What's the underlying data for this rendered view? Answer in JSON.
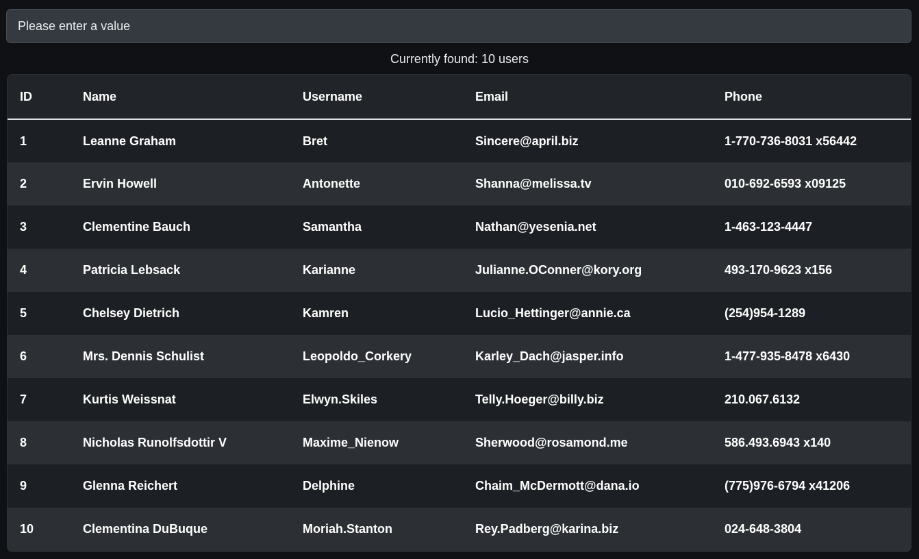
{
  "search": {
    "placeholder": "Please enter a value",
    "value": ""
  },
  "status": {
    "text": "Currently found: 10 users"
  },
  "table": {
    "headers": {
      "id": "ID",
      "name": "Name",
      "username": "Username",
      "email": "Email",
      "phone": "Phone"
    },
    "rows": [
      {
        "id": "1",
        "name": "Leanne Graham",
        "username": "Bret",
        "email": "Sincere@april.biz",
        "phone": "1-770-736-8031 x56442"
      },
      {
        "id": "2",
        "name": "Ervin Howell",
        "username": "Antonette",
        "email": "Shanna@melissa.tv",
        "phone": "010-692-6593 x09125"
      },
      {
        "id": "3",
        "name": "Clementine Bauch",
        "username": "Samantha",
        "email": "Nathan@yesenia.net",
        "phone": "1-463-123-4447"
      },
      {
        "id": "4",
        "name": "Patricia Lebsack",
        "username": "Karianne",
        "email": "Julianne.OConner@kory.org",
        "phone": "493-170-9623 x156"
      },
      {
        "id": "5",
        "name": "Chelsey Dietrich",
        "username": "Kamren",
        "email": "Lucio_Hettinger@annie.ca",
        "phone": "(254)954-1289"
      },
      {
        "id": "6",
        "name": "Mrs. Dennis Schulist",
        "username": "Leopoldo_Corkery",
        "email": "Karley_Dach@jasper.info",
        "phone": "1-477-935-8478 x6430"
      },
      {
        "id": "7",
        "name": "Kurtis Weissnat",
        "username": "Elwyn.Skiles",
        "email": "Telly.Hoeger@billy.biz",
        "phone": "210.067.6132"
      },
      {
        "id": "8",
        "name": "Nicholas Runolfsdottir V",
        "username": "Maxime_Nienow",
        "email": "Sherwood@rosamond.me",
        "phone": "586.493.6943 x140"
      },
      {
        "id": "9",
        "name": "Glenna Reichert",
        "username": "Delphine",
        "email": "Chaim_McDermott@dana.io",
        "phone": "(775)976-6794 x41206"
      },
      {
        "id": "10",
        "name": "Clementina DuBuque",
        "username": "Moriah.Stanton",
        "email": "Rey.Padberg@karina.biz",
        "phone": "024-648-3804"
      }
    ]
  },
  "colors": {
    "page_background": "#0f1114",
    "input_background": "#343a40",
    "row_odd": "#1c1f23",
    "row_even": "#2c3034",
    "header_rule": "#dee2e6"
  }
}
